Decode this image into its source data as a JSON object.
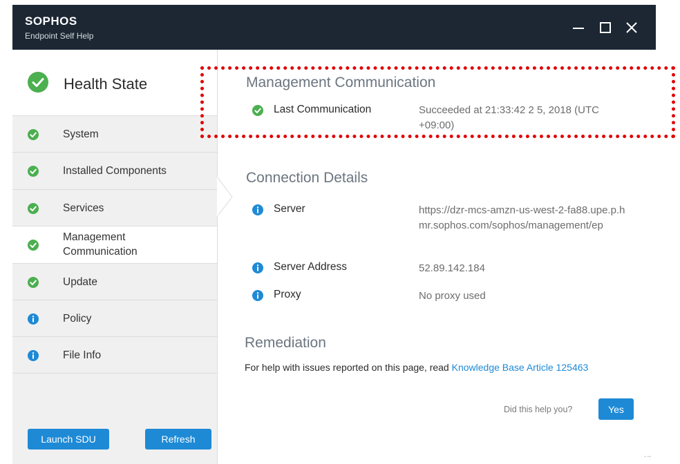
{
  "window": {
    "brand": "SOPHOS",
    "subtitle": "Endpoint Self Help",
    "controls": {
      "minimize_icon": "minimize-icon",
      "maximize_icon": "maximize-icon",
      "close_icon": "close-icon"
    }
  },
  "sidebar": {
    "health_label": "Health State",
    "items": [
      {
        "label": "System",
        "status": "ok"
      },
      {
        "label": "Installed Components",
        "status": "ok"
      },
      {
        "label": "Services",
        "status": "ok"
      },
      {
        "label": "Management\nCommunication",
        "status": "ok",
        "active": true
      },
      {
        "label": "Update",
        "status": "ok"
      },
      {
        "label": "Policy",
        "status": "info"
      },
      {
        "label": "File Info",
        "status": "info"
      }
    ],
    "launch_label": "Launch SDU",
    "refresh_label": "Refresh"
  },
  "main": {
    "management": {
      "title": "Management Communication",
      "last_comm_label": "Last Communication",
      "last_comm_value": "Succeeded at 21:33:42 2 5, 2018 (UTC +09:00)"
    },
    "connection": {
      "title": "Connection Details",
      "server_label": "Server",
      "server_value": "https://dzr-mcs-amzn-us-west-2-fa88.upe.p.hmr.sophos.com/sophos/management/ep",
      "address_label": "Server Address",
      "address_value": "52.89.142.184",
      "proxy_label": "Proxy",
      "proxy_value": "No proxy used"
    },
    "remediation": {
      "title": "Remediation",
      "text": "For help with issues reported on this page, read ",
      "link_text": "Knowledge Base Article 125463"
    },
    "feedback": {
      "question": "Did this help you?",
      "yes_label": "Yes"
    }
  },
  "colors": {
    "titlebar": "#1c2733",
    "accent": "#1e8ad6",
    "ok": "#4caf50",
    "info": "#1e8ad6",
    "highlight": "#e00000"
  }
}
